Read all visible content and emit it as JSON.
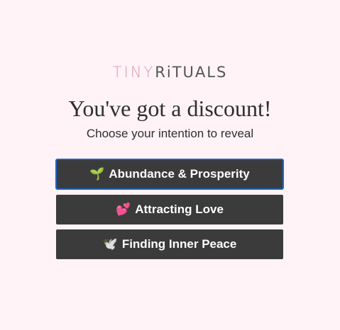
{
  "logo": {
    "part1": "TINY",
    "part2": "RiTUALS"
  },
  "headline": "You've got a discount!",
  "subhead": "Choose your intention to reveal",
  "options": [
    {
      "icon": "🌱",
      "icon_name": "seedling-icon",
      "label": "Abundance & Prosperity"
    },
    {
      "icon": "💕",
      "icon_name": "two-hearts-icon",
      "label": "Attracting Love"
    },
    {
      "icon": "🕊️",
      "icon_name": "dove-icon",
      "label": "Finding Inner Peace"
    }
  ],
  "colors": {
    "background": "#fff3f7",
    "button": "#3b3b3b",
    "focus_ring": "#1a66c9",
    "logo_accent": "#d99aaf"
  }
}
